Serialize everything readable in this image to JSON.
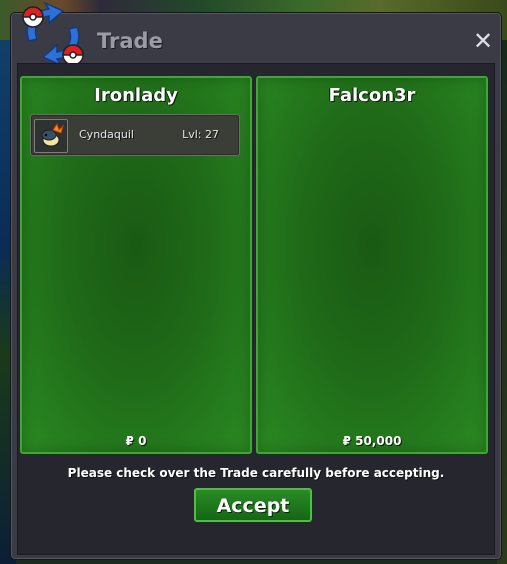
{
  "window": {
    "title": "Trade",
    "close_icon": "close-icon"
  },
  "players": [
    {
      "name": "Ironlady",
      "items": [
        {
          "name": "Cyndaquil",
          "level": "Lvl: 27",
          "icon": "cyndaquil-icon"
        }
      ],
      "money": "₽ 0"
    },
    {
      "name": "Falcon3r",
      "items": [],
      "money": "₽ 50,000"
    }
  ],
  "footer": {
    "notice": "Please check over the Trade carefully before accepting.",
    "accept_label": "Accept"
  },
  "colors": {
    "panel_green": "#1f6a18",
    "panel_border": "#3ea834",
    "window_bg": "#3b3b45",
    "accept_green": "#1e7a1c"
  }
}
